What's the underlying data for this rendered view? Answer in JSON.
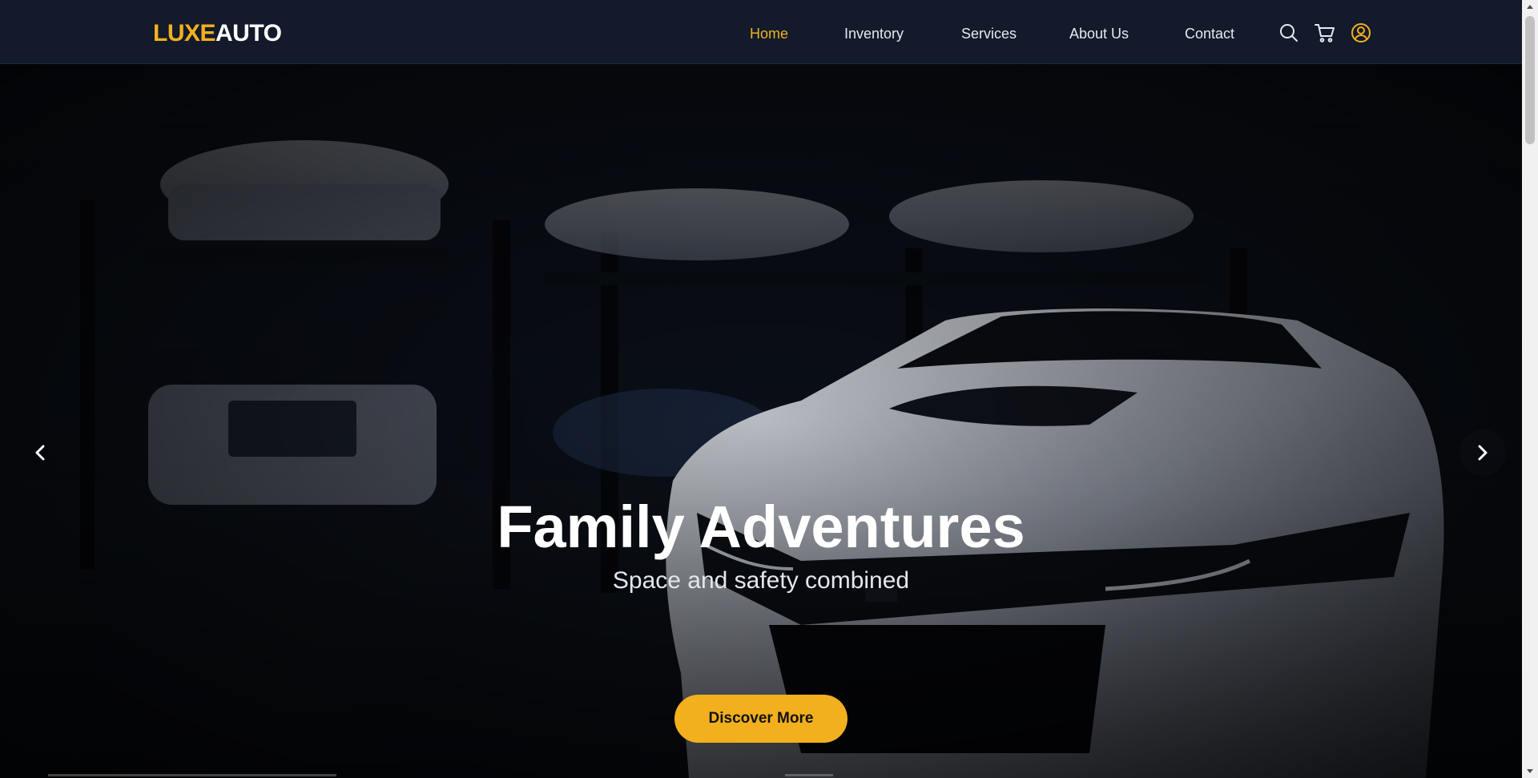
{
  "brand": {
    "part1": "LUXE",
    "part2": "AUTO"
  },
  "nav": {
    "items": [
      {
        "label": "Home",
        "active": true
      },
      {
        "label": "Inventory",
        "active": false
      },
      {
        "label": "Services",
        "active": false
      },
      {
        "label": "About Us",
        "active": false
      },
      {
        "label": "Contact",
        "active": false
      }
    ],
    "icons": [
      "search-icon",
      "cart-icon",
      "user-icon"
    ]
  },
  "hero": {
    "title": "Family Adventures",
    "subtitle": "Space and safety combined",
    "cta_label": "Discover More"
  },
  "colors": {
    "accent": "#f2b01e",
    "header_bg": "#121a2b",
    "text": "#ffffff"
  }
}
